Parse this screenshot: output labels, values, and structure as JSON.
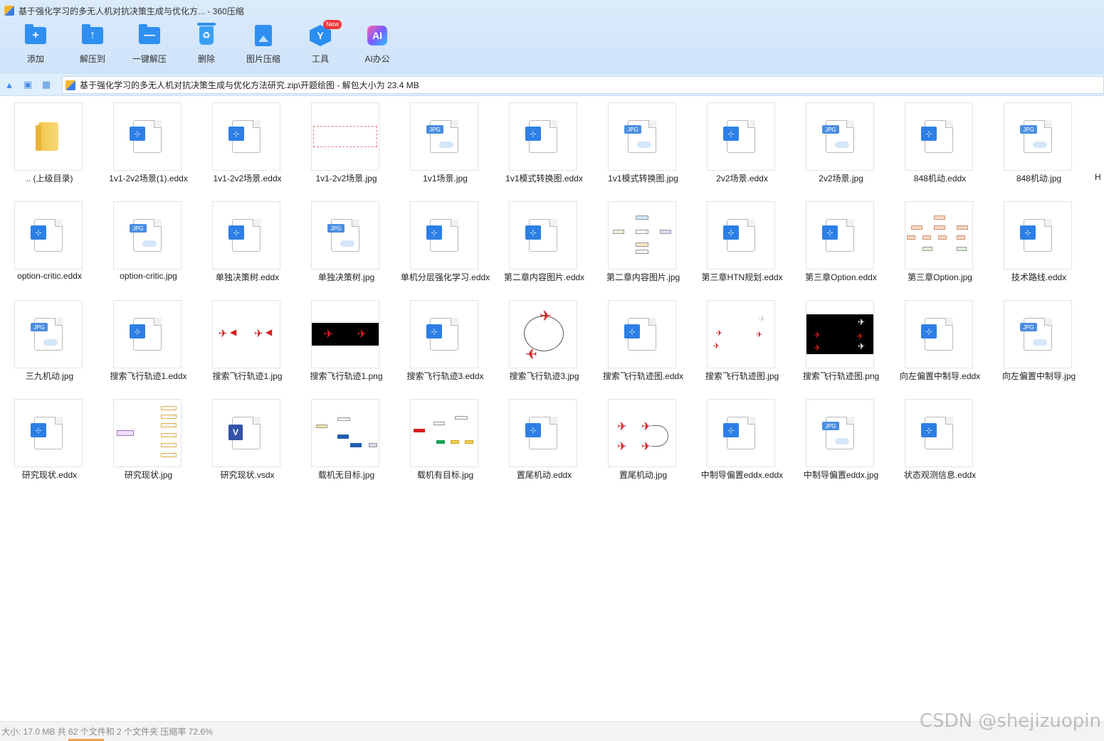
{
  "window": {
    "title": "基于强化学习的多无人机对抗决策生成与优化方...  - 360压缩"
  },
  "toolbar": {
    "add": "添加",
    "extract_to": "解压到",
    "one_click": "一键解压",
    "delete": "删除",
    "image_compress": "图片压缩",
    "tools": "工具",
    "tools_badge": "New",
    "ai_office": "AI办公"
  },
  "address": {
    "path": "基于强化学习的多无人机对抗决策生成与优化方法研究.zip\\开题绘图 - 解包大小为 23.4 MB"
  },
  "files": [
    {
      "name": ".. (上级目录)",
      "kind": "folder"
    },
    {
      "name": "1v1-2v2场景(1).eddx",
      "kind": "eddx"
    },
    {
      "name": "1v1-2v2场景.eddx",
      "kind": "eddx"
    },
    {
      "name": "1v1-2v2场景.jpg",
      "kind": "pv-wide"
    },
    {
      "name": "1v1场景.jpg",
      "kind": "jpg"
    },
    {
      "name": "1v1模式转换图.eddx",
      "kind": "eddx"
    },
    {
      "name": "1v1模式转换图.jpg",
      "kind": "jpg"
    },
    {
      "name": "2v2场景.eddx",
      "kind": "eddx"
    },
    {
      "name": "2v2场景.jpg",
      "kind": "jpg"
    },
    {
      "name": "848机动.eddx",
      "kind": "eddx"
    },
    {
      "name": "848机动.jpg",
      "kind": "jpg"
    },
    {
      "name": "option-critic.eddx",
      "kind": "eddx"
    },
    {
      "name": "option-critic.jpg",
      "kind": "jpg"
    },
    {
      "name": "单独决策树.eddx",
      "kind": "eddx"
    },
    {
      "name": "单独决策树.jpg",
      "kind": "jpg"
    },
    {
      "name": "单机分层强化学习.eddx",
      "kind": "eddx"
    },
    {
      "name": "第二章内容图片.eddx",
      "kind": "eddx"
    },
    {
      "name": "第二章内容图片.jpg",
      "kind": "pv-flow"
    },
    {
      "name": "第三章HTN规划.eddx",
      "kind": "eddx"
    },
    {
      "name": "第三章Option.eddx",
      "kind": "eddx"
    },
    {
      "name": "第三章Option.jpg",
      "kind": "pv-tree"
    },
    {
      "name": "技术路线.eddx",
      "kind": "eddx"
    },
    {
      "name": "三九机动.jpg",
      "kind": "jpg"
    },
    {
      "name": "搜索飞行轨迹1.eddx",
      "kind": "eddx"
    },
    {
      "name": "搜索飞行轨迹1.jpg",
      "kind": "pv-jets"
    },
    {
      "name": "搜索飞行轨迹1.png",
      "kind": "pv-black"
    },
    {
      "name": "搜索飞行轨迹3.eddx",
      "kind": "eddx"
    },
    {
      "name": "搜索飞行轨迹3.jpg",
      "kind": "pv-loop"
    },
    {
      "name": "搜索飞行轨迹图.eddx",
      "kind": "eddx"
    },
    {
      "name": "搜索飞行轨迹图.jpg",
      "kind": "pv-scatter"
    },
    {
      "name": "搜索飞行轨迹图.png",
      "kind": "pv-black-tall"
    },
    {
      "name": "向左偏置中制导.eddx",
      "kind": "eddx"
    },
    {
      "name": "向左偏置中制导.jpg",
      "kind": "jpg"
    },
    {
      "name": "研究现状.eddx",
      "kind": "eddx"
    },
    {
      "name": "研究现状.jpg",
      "kind": "pv-mind"
    },
    {
      "name": "研究现状.vsdx",
      "kind": "vsdx"
    },
    {
      "name": "载机无目标.jpg",
      "kind": "pv-flow2"
    },
    {
      "name": "载机有目标.jpg",
      "kind": "pv-flow3"
    },
    {
      "name": "置尾机动.eddx",
      "kind": "eddx"
    },
    {
      "name": "置尾机动.jpg",
      "kind": "pv-tail"
    },
    {
      "name": "中制导偏置eddx.eddx",
      "kind": "eddx"
    },
    {
      "name": "中制导偏置eddx.jpg",
      "kind": "jpg"
    },
    {
      "name": "状态观测信息.eddx",
      "kind": "eddx"
    }
  ],
  "partial_next": "H",
  "status": {
    "text": "大小: 17.0 MB 共 62 个文件和 2 个文件夹 压缩率 72.6%"
  },
  "watermark": "CSDN @shejizuopin",
  "colors": {
    "accent": "#2e8ff0",
    "toolbar_bg": "#d3e6fa",
    "badge": "#f23535"
  }
}
